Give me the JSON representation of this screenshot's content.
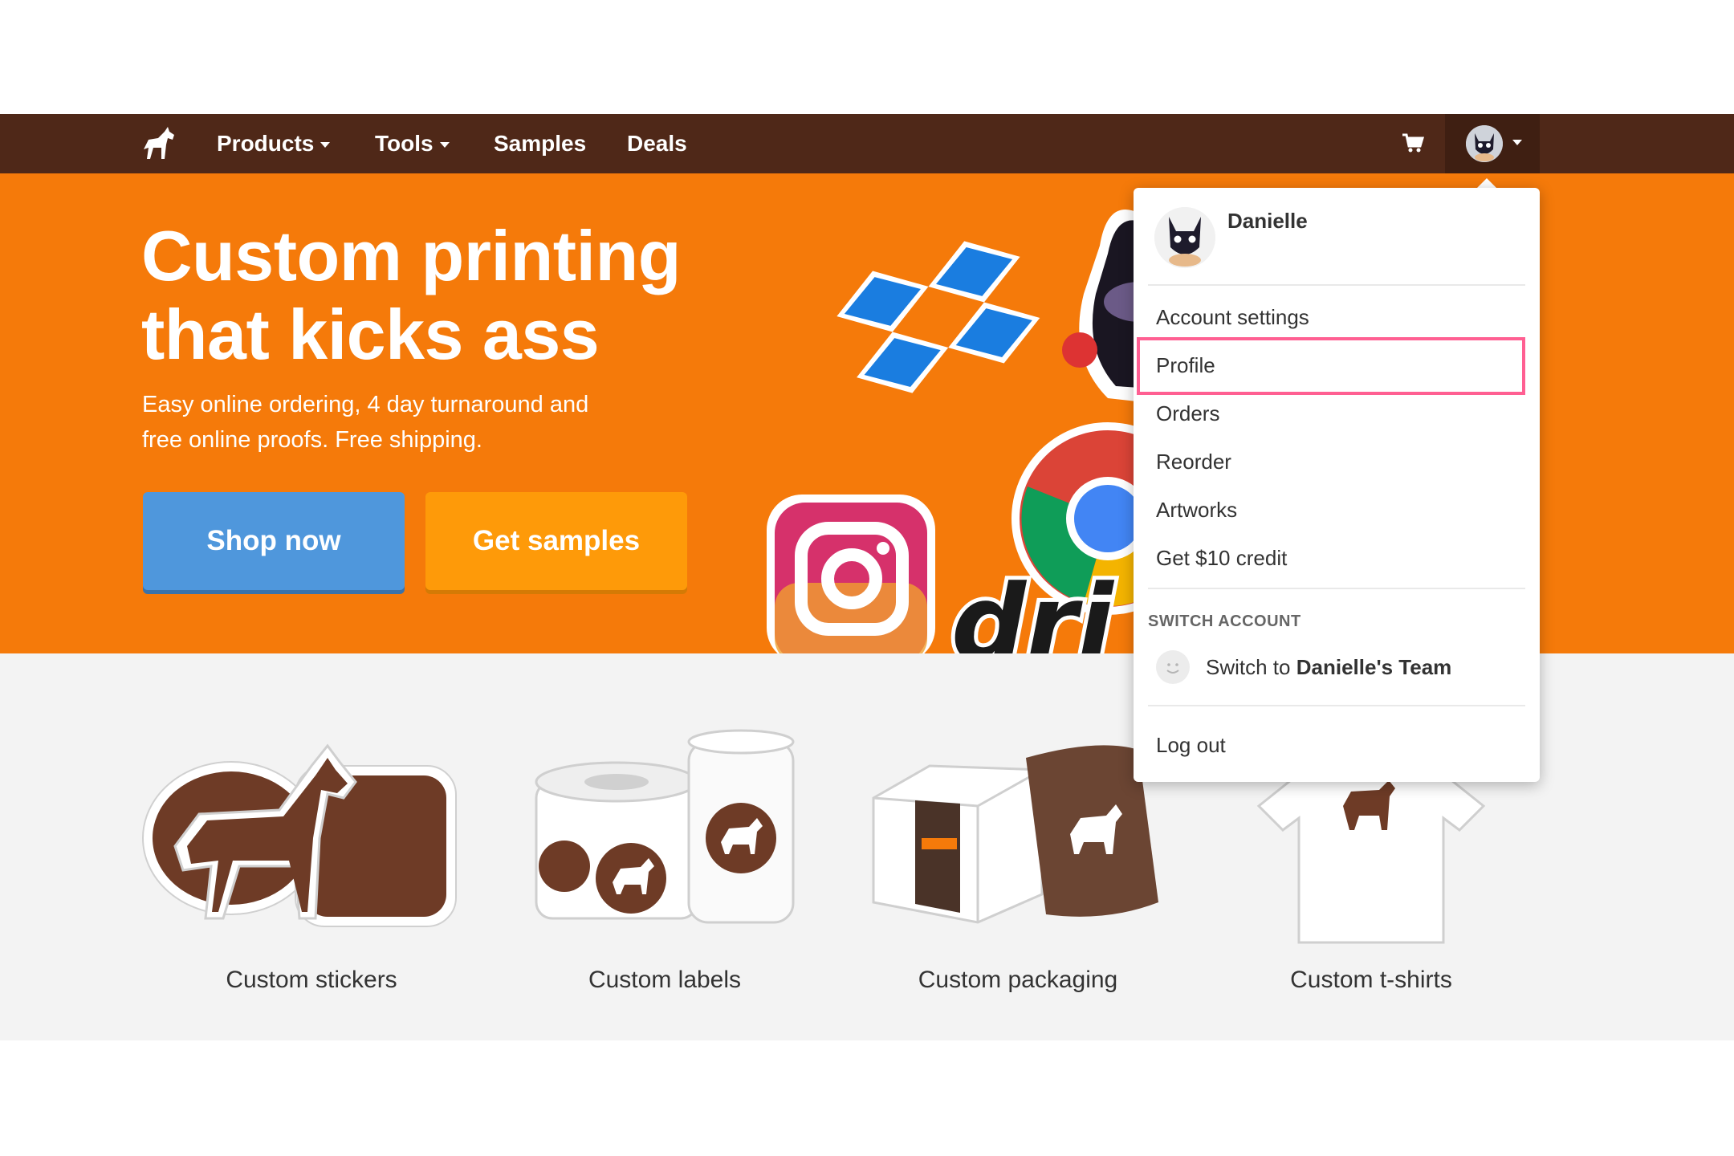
{
  "nav": {
    "items": [
      {
        "label": "Products",
        "has_dropdown": true
      },
      {
        "label": "Tools",
        "has_dropdown": true
      },
      {
        "label": "Samples",
        "has_dropdown": false
      },
      {
        "label": "Deals",
        "has_dropdown": false
      }
    ],
    "logo_icon": "horse-icon",
    "cart_icon": "cart-icon",
    "account_icon": "avatar-cat-icon"
  },
  "hero": {
    "title_line1": "Custom printing",
    "title_line2": "that kicks ass",
    "subtitle_line1": "Easy online ordering, 4 day turnaround and",
    "subtitle_line2": "free online proofs. Free shipping.",
    "shop_button": "Shop now",
    "samples_button": "Get samples"
  },
  "products": [
    {
      "label": "Custom stickers"
    },
    {
      "label": "Custom labels"
    },
    {
      "label": "Custom packaging"
    },
    {
      "label": "Custom t-shirts"
    }
  ],
  "dropdown": {
    "user_name": "Danielle",
    "items": [
      {
        "label": "Account settings"
      },
      {
        "label": "Profile",
        "highlighted": true
      },
      {
        "label": "Orders"
      },
      {
        "label": "Reorder"
      },
      {
        "label": "Artworks"
      },
      {
        "label": "Get $10 credit"
      }
    ],
    "switch_header": "SWITCH ACCOUNT",
    "switch_prefix": "Switch to",
    "switch_team": "Danielle's Team",
    "logout": "Log out"
  },
  "colors": {
    "nav_bg": "#4f2818",
    "hero_bg": "#f57a0a",
    "shop_button": "#4f97dc",
    "samples_button": "#fe9a09",
    "highlight": "#ff5f92"
  }
}
